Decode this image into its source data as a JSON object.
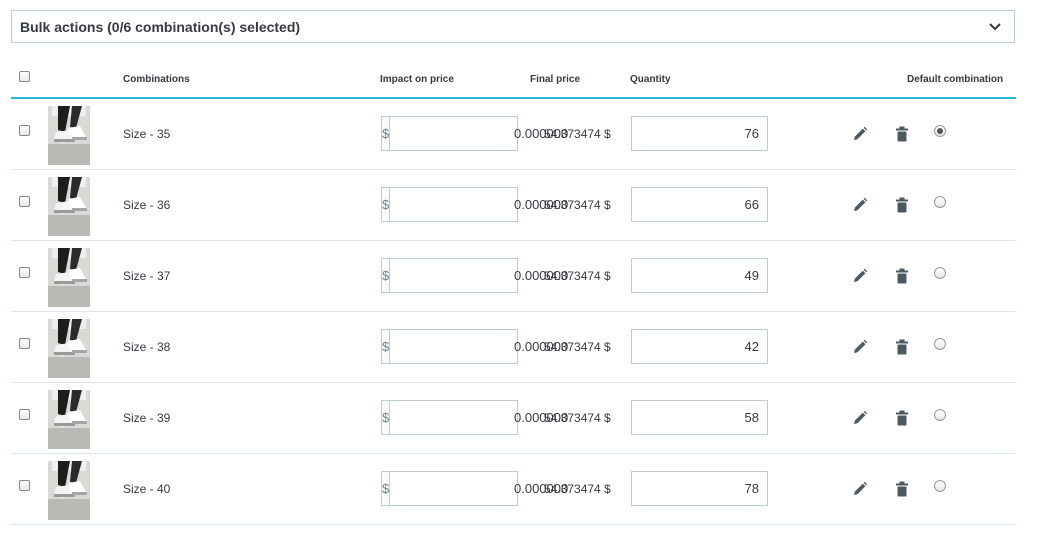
{
  "bulk_actions": {
    "label": "Bulk actions (0/6 combination(s) selected)",
    "icon": "chevron-down-icon"
  },
  "columns": {
    "combinations": "Combinations",
    "impact_on_price": "Impact on price",
    "final_price": "Final price",
    "quantity": "Quantity",
    "default_combination": "Default combination"
  },
  "currency_symbol": "$",
  "accent_color": "#25b9d7",
  "rows": [
    {
      "name": "Size - 35",
      "impact": "0.000000",
      "final_price": "54.373474 $",
      "quantity": "76",
      "is_default": true
    },
    {
      "name": "Size - 36",
      "impact": "0.000000",
      "final_price": "54.373474 $",
      "quantity": "66",
      "is_default": false
    },
    {
      "name": "Size - 37",
      "impact": "0.000000",
      "final_price": "54.373474 $",
      "quantity": "49",
      "is_default": false
    },
    {
      "name": "Size - 38",
      "impact": "0.000000",
      "final_price": "54.373474 $",
      "quantity": "42",
      "is_default": false
    },
    {
      "name": "Size - 39",
      "impact": "0.000000",
      "final_price": "54.373474 $",
      "quantity": "58",
      "is_default": false
    },
    {
      "name": "Size - 40",
      "impact": "0.000000",
      "final_price": "54.373474 $",
      "quantity": "78",
      "is_default": false
    }
  ]
}
